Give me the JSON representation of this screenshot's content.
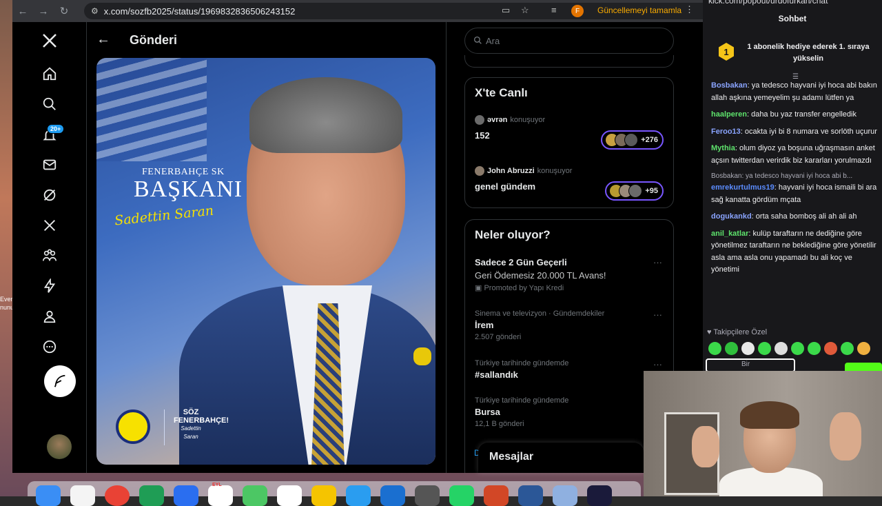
{
  "browser": {
    "url": "x.com/sozfb2025/status/1969832836506243152",
    "profile_initial": "F",
    "update_label": "Güncellemeyi tamamla"
  },
  "desktop": {
    "partial_label_1": "Ever",
    "partial_label_2": "nunu"
  },
  "nav": {
    "notifications_badge": "20+"
  },
  "post": {
    "header_title": "Gönderi",
    "image": {
      "line1": "FENERBAHÇE SK",
      "line2": "BAŞKANI",
      "signature": "Sadettin Saran",
      "slogan_1": "SÖZ",
      "slogan_2": "FENERBAHÇE!",
      "slogan_3": "Sadettin Saran"
    }
  },
  "search": {
    "placeholder": "Ara"
  },
  "live": {
    "title": "X'te Canlı",
    "speaking_label": "konuşuyor",
    "spaces": [
      {
        "host": "əvrən",
        "title": "152",
        "listeners": "+276"
      },
      {
        "host": "John Abruzzi",
        "title": "genel gündem",
        "listeners": "+95"
      }
    ]
  },
  "trends": {
    "title": "Neler oluyor?",
    "promo": {
      "title": "Sadece 2 Gün Geçerli",
      "subtitle": "Geri Ödemesiz 20.000 TL Avans!",
      "promoted": "Promoted by Yapı Kredi"
    },
    "items": [
      {
        "meta": "Sinema ve televizyon · Gündemdekiler",
        "name": "İrem",
        "count": "2.507 gönderi"
      },
      {
        "meta": "Türkiye tarihinde gündemde",
        "name": "#sallandık",
        "count": ""
      },
      {
        "meta": "Türkiye tarihinde gündemde",
        "name": "Bursa",
        "count": "12,1 B gönderi"
      }
    ]
  },
  "messages_drawer": {
    "title": "Mesajlar",
    "peek": "D"
  },
  "chat": {
    "url": "kick.com/popout/urdofurkan/chat",
    "header": "Sohbet",
    "sub_rank": "1",
    "sub_banner": "1 abonelik hediye ederek 1. sıraya yükselin",
    "messages": [
      {
        "user": "Bosbakan",
        "color": "#8aa4ff",
        "text": ": ya tedesco hayvani iyi hoca abi bakın allah aşkına yemeyelim şu adamı lütfen ya"
      },
      {
        "user": "haalperen",
        "color": "#5ee36c",
        "text": ": daha bu yaz transfer engelledik"
      },
      {
        "user": "Feroo13",
        "color": "#8aa4ff",
        "text": ": ocakta iyi bi 8 numara ve sorlöth uçurur"
      },
      {
        "user": "Mythia",
        "color": "#5ee36c",
        "text": ": olum diyoz ya boşuna uğraşmasın anket açsın twitterdan verirdik biz kararları yorulmazdı"
      },
      {
        "user": "emrekurtulmus19",
        "color": "#5b8cff",
        "text": ": hayvani iyi hoca ismaili bi ara sağ kanatta gördüm mçata",
        "reply": "Bosbakan: ya tedesco hayvani iyi hoca abi b..."
      },
      {
        "user": "dogukankd",
        "color": "#8aa4ff",
        "text": ": orta saha bomboş ali ah ali ah"
      },
      {
        "user": "anil_katlar",
        "color": "#5ee36c",
        "text": ": kulüp taraftarın ne dediğine göre yönetilmez taraftarın ne beklediğine göre yönetilir asla ama asla onu yapamadı bu ali koç ve yönetimi"
      }
    ],
    "follower_only": "Takipçilere Özel",
    "input_placeholder": "Bir"
  },
  "dock": {
    "calendar_month": "EYL"
  },
  "colors": {
    "x_bg": "#000000",
    "x_border": "#2f3336",
    "x_text": "#e7e9ea",
    "x_muted": "#71767b",
    "x_blue": "#1d9bf0",
    "kick_green": "#53fc18",
    "chat_bg": "#18181b"
  }
}
